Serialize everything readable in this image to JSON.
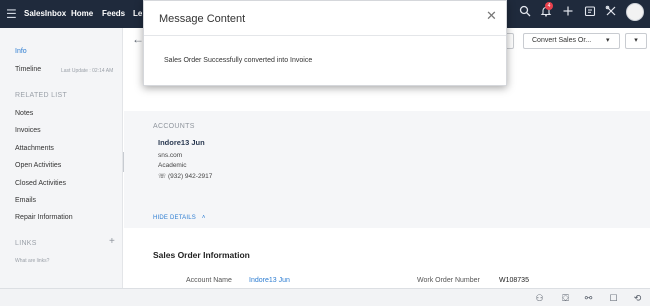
{
  "topbar": {
    "brand": "SalesInbox",
    "nav": [
      "Home",
      "Feeds",
      "Le"
    ],
    "notification_count": "4"
  },
  "sidebar": {
    "info": "Info",
    "timeline": "Timeline",
    "timeline_sub": "Last Update : 02:14 AM",
    "related_list_heading": "RELATED LIST",
    "related_items": [
      "Notes",
      "Invoices",
      "Attachments",
      "Open Activities",
      "Closed Activities",
      "Emails",
      "Repair Information"
    ],
    "links_heading": "LINKS",
    "links_sub": "What are links?"
  },
  "toolbar": {
    "convert_label": "Convert Sales Or...",
    "more_label": "..."
  },
  "account": {
    "heading": "ACCOUNTS",
    "name": "Indore13 Jun",
    "website": "sns.com",
    "industry": "Academic",
    "phone": "(932) 942-2917"
  },
  "details": {
    "hide_details": "HIDE DETAILS",
    "section_title": "Sales Order Information",
    "account_name_label": "Account Name",
    "account_name_value": "Indore13 Jun",
    "work_order_label": "Work Order Number",
    "work_order_value": "W108735"
  },
  "modal": {
    "title": "Message Content",
    "message": "Sales Order Successfully converted into Invoice"
  },
  "icons": {
    "search": "search-icon",
    "bell": "bell-icon",
    "plus": "plus-icon",
    "calendar": "calendar-icon",
    "tools": "tools-icon"
  },
  "colors": {
    "topbar": "#1f2a3c",
    "accent": "#2d7dd2",
    "badge": "#e8414d"
  }
}
